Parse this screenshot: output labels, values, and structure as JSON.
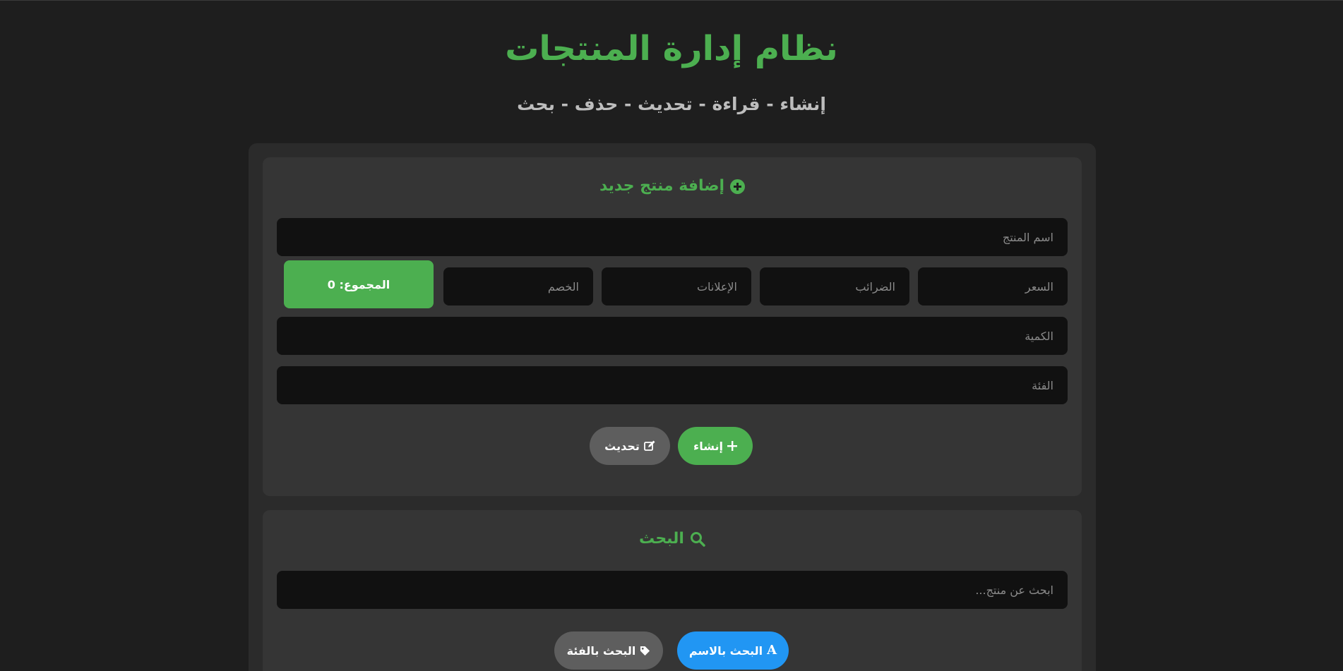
{
  "header": {
    "title": "نظام إدارة المنتجات",
    "subtitle": "إنشاء - قراءة - تحديث - حذف - بحث"
  },
  "create_card": {
    "title": "إضافة منتج جديد",
    "title_icon": "plus-circle-icon",
    "fields": {
      "name_placeholder": "اسم المنتج",
      "price_placeholder": "السعر",
      "taxes_placeholder": "الضرائب",
      "ads_placeholder": "الإعلانات",
      "discount_placeholder": "الخصم",
      "quantity_placeholder": "الكمية",
      "category_placeholder": "الفئة"
    },
    "total_label": "المجموع: 0",
    "buttons": {
      "create_label": "إنشاء",
      "create_icon": "plus-icon",
      "update_label": "تحديث",
      "update_icon": "edit-icon"
    }
  },
  "search_card": {
    "title": "البحث",
    "title_icon": "search-icon",
    "search_placeholder": "ابحث عن منتج...",
    "buttons": {
      "by_name_label": "البحث بالاسم",
      "by_name_icon": "font-icon",
      "by_category_label": "البحث بالفئة",
      "by_category_icon": "tag-icon"
    }
  },
  "colors": {
    "accent": "#4caf50",
    "blue": "#2196f3",
    "background": "#1e1e1e",
    "card": "#353535",
    "input": "#111111",
    "secondary_button": "#5e5e5e"
  }
}
